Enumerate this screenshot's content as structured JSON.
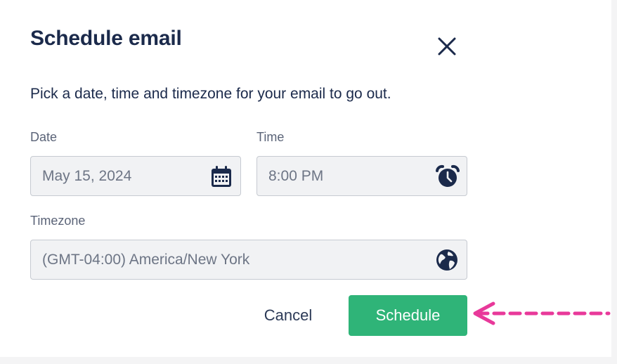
{
  "dialog": {
    "title": "Schedule email",
    "description": "Pick a date, time and timezone for your email to go out.",
    "close_icon": "close-icon"
  },
  "form": {
    "date": {
      "label": "Date",
      "value": "May 15, 2024",
      "icon": "calendar-icon"
    },
    "time": {
      "label": "Time",
      "value": "8:00 PM",
      "icon": "alarm-clock-icon"
    },
    "timezone": {
      "label": "Timezone",
      "value": "(GMT-04:00) America/New York",
      "icon": "globe-icon"
    }
  },
  "actions": {
    "cancel_label": "Cancel",
    "schedule_label": "Schedule"
  },
  "annotation": {
    "arrow_color": "#e8399a",
    "icon": "dashed-arrow-icon"
  },
  "colors": {
    "primary": "#2fb478",
    "text_dark": "#1b2a4b",
    "field_bg": "#f1f2f4"
  }
}
